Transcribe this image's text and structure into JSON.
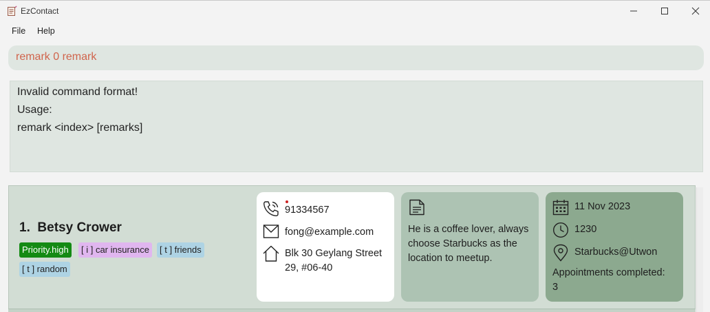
{
  "window": {
    "title": "EzContact",
    "icons": {
      "app": "notepad-icon",
      "minimize": "minimize-icon",
      "maximize": "maximize-icon",
      "close": "close-icon"
    }
  },
  "menu": {
    "file": "File",
    "help": "Help"
  },
  "command": {
    "value": "remark 0 remark"
  },
  "result": {
    "line1": "Invalid command format!",
    "line2": "Usage:",
    "line3": "remark <index> [remarks]"
  },
  "person": {
    "index": "1.",
    "name": "Betsy Crower",
    "tags": {
      "priority": "Priority.high",
      "insurance": "[ i ] car insurance",
      "friends": "[ t ] friends",
      "random": "[ t ] random"
    },
    "phone": "91334567",
    "email": "fong@example.com",
    "address_line1": "Blk 30 Geylang Street",
    "address_line2": "29, #06-40",
    "remark_line1": "He is a coffee lover, always",
    "remark_line2": "choose Starbucks as the",
    "remark_line3": "location to meetup.",
    "appointment": {
      "date": "11 Nov 2023",
      "time": "1230",
      "venue": "Starbucks@Utwon",
      "completed_line1": "Appointments completed:",
      "completed_line2": "3"
    }
  },
  "colors": {
    "command_text": "#d0644c",
    "priority_tag": "#138a13",
    "insurance_tag": "#e0b6ef",
    "t_tag": "#aed3e4",
    "remark_card": "#adc3b3",
    "appointment_card": "#8ca98f"
  }
}
